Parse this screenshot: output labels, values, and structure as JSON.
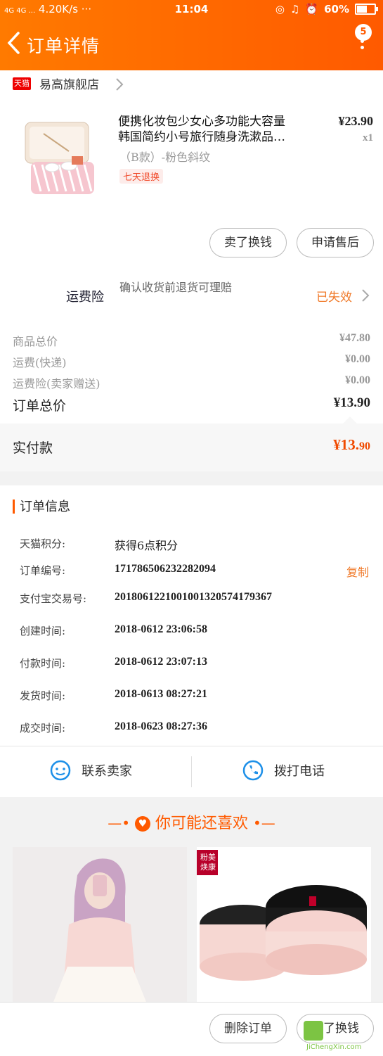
{
  "status_bar": {
    "signal": "4G 4G ...",
    "net_speed": "4.20K/s ···",
    "time": "11:04",
    "battery": "60%"
  },
  "header": {
    "title": "订单详情",
    "badge_count": "5"
  },
  "shop": {
    "badge": "天猫",
    "name": "易高旗舰店"
  },
  "product": {
    "title_line1": "便携化妆包少女心多功能大容量",
    "title_line2": "韩国简约小号旅行随身洗漱品…",
    "price": "¥23.90",
    "qty": "x1",
    "sku": "（B款）-粉色斜纹",
    "tag": "七天退换",
    "btn_buy_again": "卖了换钱",
    "btn_after_sale": "申请售后"
  },
  "insurance": {
    "label": "运费险",
    "desc": "确认收货前退货可理赔",
    "status": "已失效"
  },
  "summary": {
    "rows": [
      {
        "label": "商品总价",
        "value": "¥47.80"
      },
      {
        "label": "运费(快递)",
        "value": "¥0.00"
      },
      {
        "label": "运费险(卖家赠送)",
        "value": "¥0.00"
      }
    ],
    "total_label": "订单总价",
    "total_value": "¥13.90",
    "paid_label": "实付款",
    "paid_value_main": "¥13.",
    "paid_value_decimal": "90"
  },
  "order_info": {
    "section_title": "订单信息",
    "rows": [
      {
        "k": "天猫积分:",
        "v": "获得6点积分"
      },
      {
        "k": "订单编号:",
        "v": "171786506232282094"
      },
      {
        "k": "支付宝交易号:",
        "v": "2018061221001001320574179367"
      },
      {
        "k": "创建时间:",
        "v": "2018-0612 23:06:58"
      },
      {
        "k": "付款时间:",
        "v": "2018-0612 23:07:13"
      },
      {
        "k": "发货时间:",
        "v": "2018-0613 08:27:21"
      },
      {
        "k": "成交时间:",
        "v": "2018-0623 08:27:36"
      }
    ],
    "copy_label": "复制"
  },
  "contact": {
    "seller": "联系卖家",
    "call": "拨打电话"
  },
  "recommend": {
    "title": "你可能还喜欢",
    "product2_badge": "粉美焕康"
  },
  "footer": {
    "delete": "删除订单",
    "resell": "卖了换钱"
  },
  "watermark": {
    "text": "JiChengXin.com"
  }
}
